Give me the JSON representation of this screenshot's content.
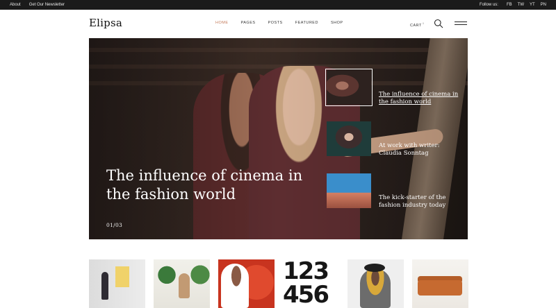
{
  "topbar": {
    "about": "About",
    "newsletter": "Get Our Newsletter",
    "follow_label": "Follow us:",
    "social": [
      "FB",
      "TW",
      "YT",
      "PN"
    ]
  },
  "header": {
    "logo": "Elipsa",
    "nav": [
      "HOME",
      "PAGES",
      "POSTS",
      "FEATURED",
      "SHOP"
    ],
    "active_nav": "HOME",
    "cart_label": "CART",
    "cart_count": "0"
  },
  "hero": {
    "title": "The influence of cinema in the fashion world",
    "counter": "01/03",
    "side_items": [
      {
        "title": "The influence of cinema in the fashion world",
        "active": true
      },
      {
        "title": "At work with writer: Claudia Sonntag",
        "active": false
      },
      {
        "title": "The kick-starter of the fashion industry today",
        "active": false
      }
    ]
  },
  "strip": {
    "card4_line1": "123",
    "card4_line2": "456"
  },
  "colors": {
    "accent": "#c47a5a",
    "topbar": "#1b1b1b"
  }
}
